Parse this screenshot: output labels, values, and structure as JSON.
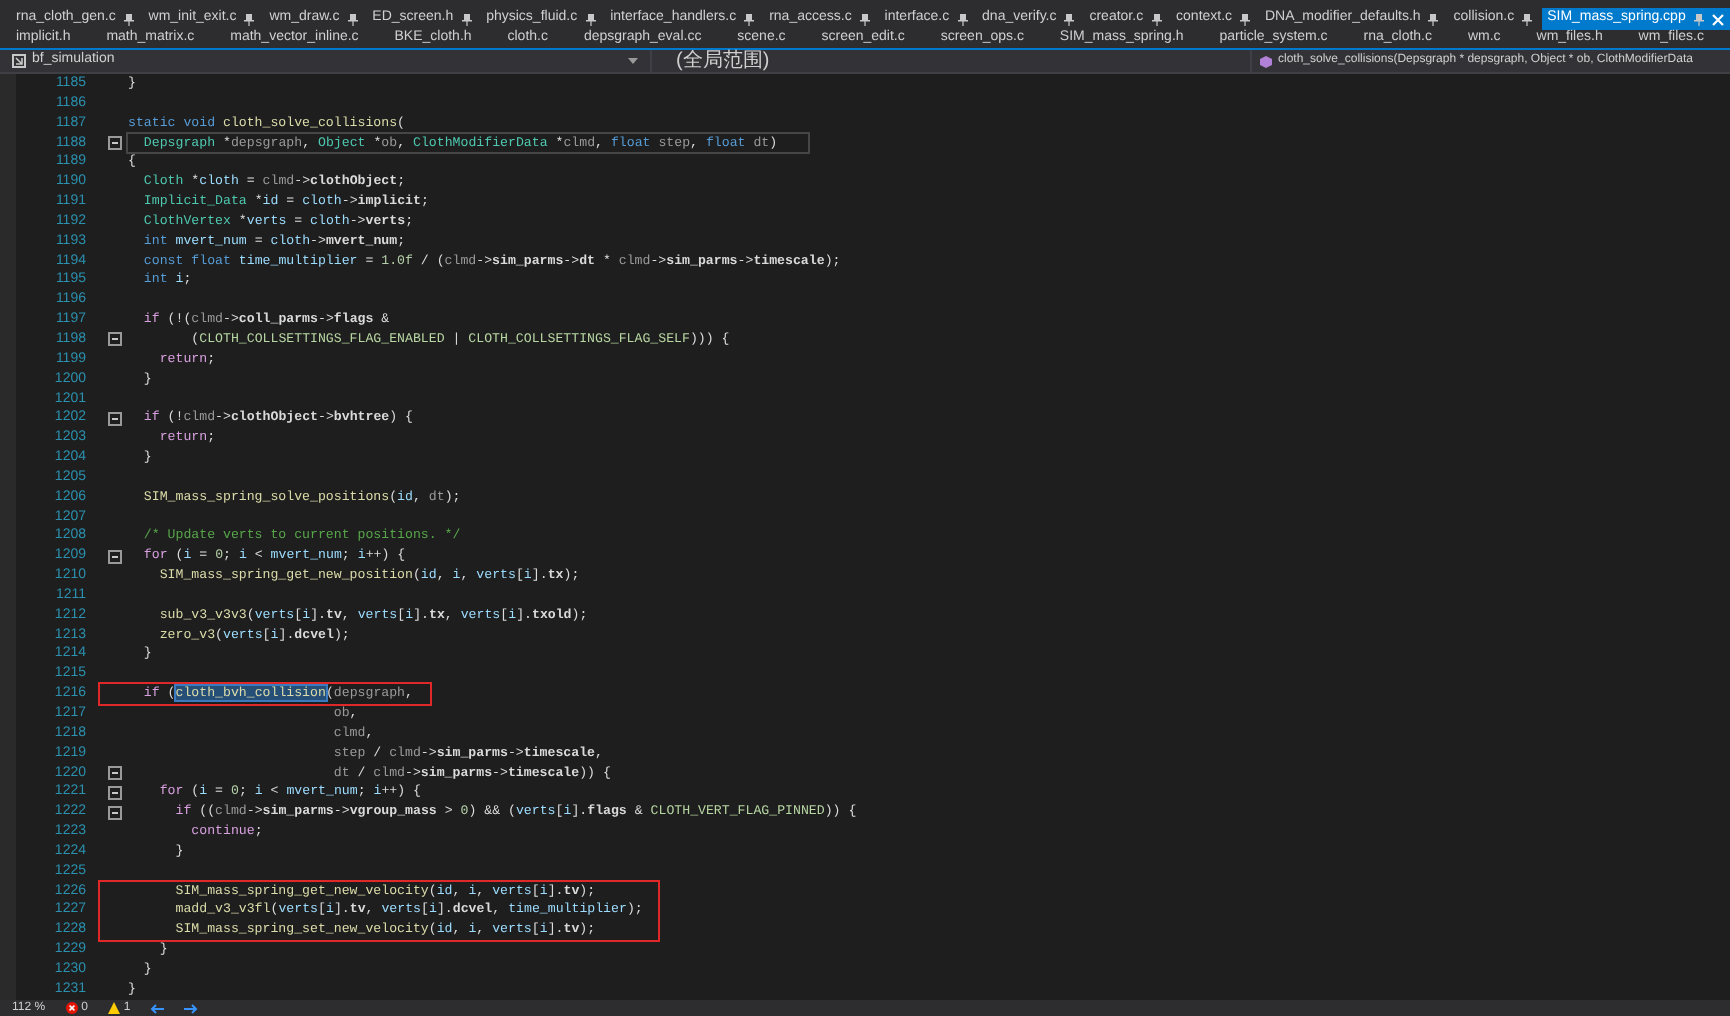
{
  "tabs_row_1": [
    {
      "label": "rna_cloth_gen.c",
      "pinned": true,
      "selected": false
    },
    {
      "label": "wm_init_exit.c",
      "pinned": true,
      "selected": false
    },
    {
      "label": "wm_draw.c",
      "pinned": true,
      "selected": false
    },
    {
      "label": "ED_screen.h",
      "pinned": true,
      "selected": false
    },
    {
      "label": "physics_fluid.c",
      "pinned": true,
      "selected": false
    },
    {
      "label": "interface_handlers.c",
      "pinned": true,
      "selected": false
    },
    {
      "label": "rna_access.c",
      "pinned": true,
      "selected": false
    },
    {
      "label": "interface.c",
      "pinned": true,
      "selected": false
    },
    {
      "label": "dna_verify.c",
      "pinned": true,
      "selected": false
    },
    {
      "label": "creator.c",
      "pinned": true,
      "selected": false
    },
    {
      "label": "context.c",
      "pinned": true,
      "selected": false
    },
    {
      "label": "DNA_modifier_defaults.h",
      "pinned": true,
      "selected": false
    },
    {
      "label": "collision.c",
      "pinned": true,
      "selected": false
    },
    {
      "label": "SIM_mass_spring.cpp",
      "pinned": true,
      "selected": true
    }
  ],
  "tabs_row_2": [
    {
      "label": "implicit.h",
      "selected": false
    },
    {
      "label": "math_matrix.c",
      "selected": false
    },
    {
      "label": "math_vector_inline.c",
      "selected": false
    },
    {
      "label": "BKE_cloth.h",
      "selected": false
    },
    {
      "label": "cloth.c",
      "selected": false
    },
    {
      "label": "depsgraph_eval.cc",
      "selected": false
    },
    {
      "label": "scene.c",
      "selected": false
    },
    {
      "label": "screen_edit.c",
      "selected": false
    },
    {
      "label": "screen_ops.c",
      "selected": false
    },
    {
      "label": "SIM_mass_spring.h",
      "selected": false
    },
    {
      "label": "particle_system.c",
      "selected": false
    },
    {
      "label": "rna_cloth.c",
      "selected": false
    },
    {
      "label": "wm.c",
      "selected": false
    },
    {
      "label": "wm_files.h",
      "selected": false
    },
    {
      "label": "wm_files.c",
      "selected": false
    }
  ],
  "navigation_bar": {
    "project": "bf_simulation",
    "scope": "(全局范围)",
    "function": "cloth_solve_collisions(Depsgraph * depsgraph, Object * ob, ClothModifierData"
  },
  "code_lines": [
    {
      "number": "1185",
      "foldable": false,
      "current": false,
      "marked": false,
      "tokens": [
        {
          "kind": "plain",
          "text": "}"
        }
      ]
    },
    {
      "number": "1186",
      "foldable": false,
      "current": false,
      "marked": false
    },
    {
      "number": "1187",
      "foldable": false,
      "current": false,
      "marked": false,
      "tokens": [
        {
          "kind": "keyword",
          "text": "static void "
        },
        {
          "kind": "function",
          "text": "cloth_solve_collisions"
        },
        {
          "kind": "plain",
          "text": "("
        }
      ]
    },
    {
      "number": "1188",
      "foldable": true,
      "current": true,
      "marked": false,
      "tokens": [
        {
          "kind": "type",
          "text": "  Depsgraph"
        },
        {
          "kind": "plain",
          "text": " *"
        },
        {
          "kind": "param",
          "text": "depsgraph"
        },
        {
          "kind": "plain",
          "text": ", "
        },
        {
          "kind": "type",
          "text": "Object"
        },
        {
          "kind": "plain",
          "text": " *"
        },
        {
          "kind": "param",
          "text": "ob"
        },
        {
          "kind": "plain",
          "text": ", "
        },
        {
          "kind": "type",
          "text": "ClothModifierData"
        },
        {
          "kind": "plain",
          "text": " *"
        },
        {
          "kind": "param",
          "text": "clmd"
        },
        {
          "kind": "plain",
          "text": ", "
        },
        {
          "kind": "keyword",
          "text": "float "
        },
        {
          "kind": "param",
          "text": "step"
        },
        {
          "kind": "plain",
          "text": ", "
        },
        {
          "kind": "keyword",
          "text": "float "
        },
        {
          "kind": "param",
          "text": "dt"
        },
        {
          "kind": "plain",
          "text": ")"
        }
      ]
    },
    {
      "number": "1189",
      "foldable": false,
      "current": false,
      "marked": false,
      "tokens": [
        {
          "kind": "plain",
          "text": "{"
        }
      ]
    },
    {
      "number": "1190",
      "foldable": false,
      "current": false,
      "marked": false,
      "tokens": [
        {
          "kind": "type",
          "text": "  Cloth"
        },
        {
          "kind": "plain",
          "text": " *"
        },
        {
          "kind": "variable",
          "text": "cloth"
        },
        {
          "kind": "plain",
          "text": " = "
        },
        {
          "kind": "param",
          "text": "clmd"
        },
        {
          "kind": "plain",
          "text": "->"
        },
        {
          "kind": "member",
          "text": "clothObject"
        },
        {
          "kind": "plain",
          "text": ";"
        }
      ]
    },
    {
      "number": "1191",
      "foldable": false,
      "current": false,
      "marked": false,
      "tokens": [
        {
          "kind": "type",
          "text": "  Implicit_Data"
        },
        {
          "kind": "plain",
          "text": " *"
        },
        {
          "kind": "variable",
          "text": "id"
        },
        {
          "kind": "plain",
          "text": " = "
        },
        {
          "kind": "variable",
          "text": "cloth"
        },
        {
          "kind": "plain",
          "text": "->"
        },
        {
          "kind": "member",
          "text": "implicit"
        },
        {
          "kind": "plain",
          "text": ";"
        }
      ]
    },
    {
      "number": "1192",
      "foldable": false,
      "current": false,
      "marked": false,
      "tokens": [
        {
          "kind": "type",
          "text": "  ClothVertex"
        },
        {
          "kind": "plain",
          "text": " *"
        },
        {
          "kind": "variable",
          "text": "verts"
        },
        {
          "kind": "plain",
          "text": " = "
        },
        {
          "kind": "variable",
          "text": "cloth"
        },
        {
          "kind": "plain",
          "text": "->"
        },
        {
          "kind": "member",
          "text": "verts"
        },
        {
          "kind": "plain",
          "text": ";"
        }
      ]
    },
    {
      "number": "1193",
      "foldable": false,
      "current": false,
      "marked": false,
      "tokens": [
        {
          "kind": "keyword",
          "text": "  int "
        },
        {
          "kind": "variable",
          "text": "mvert_num"
        },
        {
          "kind": "plain",
          "text": " = "
        },
        {
          "kind": "variable",
          "text": "cloth"
        },
        {
          "kind": "plain",
          "text": "->"
        },
        {
          "kind": "member",
          "text": "mvert_num"
        },
        {
          "kind": "plain",
          "text": ";"
        }
      ]
    },
    {
      "number": "1194",
      "foldable": false,
      "current": false,
      "marked": false,
      "tokens": [
        {
          "kind": "keyword",
          "text": "  const float "
        },
        {
          "kind": "variable",
          "text": "time_multiplier"
        },
        {
          "kind": "plain",
          "text": " = "
        },
        {
          "kind": "number",
          "text": "1.0f"
        },
        {
          "kind": "plain",
          "text": " / ("
        },
        {
          "kind": "param",
          "text": "clmd"
        },
        {
          "kind": "plain",
          "text": "->"
        },
        {
          "kind": "member",
          "text": "sim_parms"
        },
        {
          "kind": "plain",
          "text": "->"
        },
        {
          "kind": "member",
          "text": "dt"
        },
        {
          "kind": "plain",
          "text": " * "
        },
        {
          "kind": "param",
          "text": "clmd"
        },
        {
          "kind": "plain",
          "text": "->"
        },
        {
          "kind": "member",
          "text": "sim_parms"
        },
        {
          "kind": "plain",
          "text": "->"
        },
        {
          "kind": "member",
          "text": "timescale"
        },
        {
          "kind": "plain",
          "text": ");"
        }
      ]
    },
    {
      "number": "1195",
      "foldable": false,
      "current": false,
      "marked": false,
      "tokens": [
        {
          "kind": "keyword",
          "text": "  int "
        },
        {
          "kind": "variable",
          "text": "i"
        },
        {
          "kind": "plain",
          "text": ";"
        }
      ]
    },
    {
      "number": "1196",
      "foldable": false,
      "current": false,
      "marked": false
    },
    {
      "number": "1197",
      "foldable": false,
      "current": false,
      "marked": false,
      "tokens": [
        {
          "kind": "control",
          "text": "  if"
        },
        {
          "kind": "plain",
          "text": " (!("
        },
        {
          "kind": "param",
          "text": "clmd"
        },
        {
          "kind": "plain",
          "text": "->"
        },
        {
          "kind": "member",
          "text": "coll_parms"
        },
        {
          "kind": "plain",
          "text": "->"
        },
        {
          "kind": "member",
          "text": "flags"
        },
        {
          "kind": "plain",
          "text": " &"
        }
      ]
    },
    {
      "number": "1198",
      "foldable": true,
      "current": false,
      "marked": false,
      "tokens": [
        {
          "kind": "plain",
          "text": "        ("
        },
        {
          "kind": "macro",
          "text": "CLOTH_COLLSETTINGS_FLAG_ENABLED"
        },
        {
          "kind": "plain",
          "text": " | "
        },
        {
          "kind": "macro",
          "text": "CLOTH_COLLSETTINGS_FLAG_SELF"
        },
        {
          "kind": "plain",
          "text": "))) {"
        }
      ]
    },
    {
      "number": "1199",
      "foldable": false,
      "current": false,
      "marked": false,
      "tokens": [
        {
          "kind": "control",
          "text": "    return"
        },
        {
          "kind": "plain",
          "text": ";"
        }
      ]
    },
    {
      "number": "1200",
      "foldable": false,
      "current": false,
      "marked": false,
      "tokens": [
        {
          "kind": "plain",
          "text": "  }"
        }
      ]
    },
    {
      "number": "1201",
      "foldable": false,
      "current": false,
      "marked": false
    },
    {
      "number": "1202",
      "foldable": true,
      "current": false,
      "marked": false,
      "tokens": [
        {
          "kind": "control",
          "text": "  if"
        },
        {
          "kind": "plain",
          "text": " (!"
        },
        {
          "kind": "param",
          "text": "clmd"
        },
        {
          "kind": "plain",
          "text": "->"
        },
        {
          "kind": "member",
          "text": "clothObject"
        },
        {
          "kind": "plain",
          "text": "->"
        },
        {
          "kind": "member",
          "text": "bvhtree"
        },
        {
          "kind": "plain",
          "text": ") {"
        }
      ]
    },
    {
      "number": "1203",
      "foldable": false,
      "current": false,
      "marked": false,
      "tokens": [
        {
          "kind": "control",
          "text": "    return"
        },
        {
          "kind": "plain",
          "text": ";"
        }
      ]
    },
    {
      "number": "1204",
      "foldable": false,
      "current": false,
      "marked": false,
      "tokens": [
        {
          "kind": "plain",
          "text": "  }"
        }
      ]
    },
    {
      "number": "1205",
      "foldable": false,
      "current": false,
      "marked": false
    },
    {
      "number": "1206",
      "foldable": false,
      "current": false,
      "marked": false,
      "tokens": [
        {
          "kind": "function",
          "text": "  SIM_mass_spring_solve_positions"
        },
        {
          "kind": "plain",
          "text": "("
        },
        {
          "kind": "variable",
          "text": "id"
        },
        {
          "kind": "plain",
          "text": ", "
        },
        {
          "kind": "param",
          "text": "dt"
        },
        {
          "kind": "plain",
          "text": ");"
        }
      ]
    },
    {
      "number": "1207",
      "foldable": false,
      "current": false,
      "marked": false
    },
    {
      "number": "1208",
      "foldable": false,
      "current": false,
      "marked": false,
      "tokens": [
        {
          "kind": "comment",
          "text": "  /* Update verts to current positions. */"
        }
      ]
    },
    {
      "number": "1209",
      "foldable": true,
      "current": false,
      "marked": false,
      "tokens": [
        {
          "kind": "control",
          "text": "  for"
        },
        {
          "kind": "plain",
          "text": " ("
        },
        {
          "kind": "variable",
          "text": "i"
        },
        {
          "kind": "plain",
          "text": " = "
        },
        {
          "kind": "number",
          "text": "0"
        },
        {
          "kind": "plain",
          "text": "; "
        },
        {
          "kind": "variable",
          "text": "i"
        },
        {
          "kind": "plain",
          "text": " < "
        },
        {
          "kind": "variable",
          "text": "mvert_num"
        },
        {
          "kind": "plain",
          "text": "; "
        },
        {
          "kind": "variable",
          "text": "i"
        },
        {
          "kind": "plain",
          "text": "++) {"
        }
      ]
    },
    {
      "number": "1210",
      "foldable": false,
      "current": false,
      "marked": false,
      "tokens": [
        {
          "kind": "function",
          "text": "    SIM_mass_spring_get_new_position"
        },
        {
          "kind": "plain",
          "text": "("
        },
        {
          "kind": "variable",
          "text": "id"
        },
        {
          "kind": "plain",
          "text": ", "
        },
        {
          "kind": "variable",
          "text": "i"
        },
        {
          "kind": "plain",
          "text": ", "
        },
        {
          "kind": "variable",
          "text": "verts"
        },
        {
          "kind": "plain",
          "text": "["
        },
        {
          "kind": "variable",
          "text": "i"
        },
        {
          "kind": "plain",
          "text": "]."
        },
        {
          "kind": "member",
          "text": "tx"
        },
        {
          "kind": "plain",
          "text": ");"
        }
      ]
    },
    {
      "number": "1211",
      "foldable": false,
      "current": false,
      "marked": false
    },
    {
      "number": "1212",
      "foldable": false,
      "current": false,
      "marked": false,
      "tokens": [
        {
          "kind": "function",
          "text": "    sub_v3_v3v3"
        },
        {
          "kind": "plain",
          "text": "("
        },
        {
          "kind": "variable",
          "text": "verts"
        },
        {
          "kind": "plain",
          "text": "["
        },
        {
          "kind": "variable",
          "text": "i"
        },
        {
          "kind": "plain",
          "text": "]."
        },
        {
          "kind": "member",
          "text": "tv"
        },
        {
          "kind": "plain",
          "text": ", "
        },
        {
          "kind": "variable",
          "text": "verts"
        },
        {
          "kind": "plain",
          "text": "["
        },
        {
          "kind": "variable",
          "text": "i"
        },
        {
          "kind": "plain",
          "text": "]."
        },
        {
          "kind": "member",
          "text": "tx"
        },
        {
          "kind": "plain",
          "text": ", "
        },
        {
          "kind": "variable",
          "text": "verts"
        },
        {
          "kind": "plain",
          "text": "["
        },
        {
          "kind": "variable",
          "text": "i"
        },
        {
          "kind": "plain",
          "text": "]."
        },
        {
          "kind": "member",
          "text": "txold"
        },
        {
          "kind": "plain",
          "text": ");"
        }
      ]
    },
    {
      "number": "1213",
      "foldable": false,
      "current": false,
      "marked": false,
      "tokens": [
        {
          "kind": "function",
          "text": "    zero_v3"
        },
        {
          "kind": "plain",
          "text": "("
        },
        {
          "kind": "variable",
          "text": "verts"
        },
        {
          "kind": "plain",
          "text": "["
        },
        {
          "kind": "variable",
          "text": "i"
        },
        {
          "kind": "plain",
          "text": "]."
        },
        {
          "kind": "member",
          "text": "dcvel"
        },
        {
          "kind": "plain",
          "text": ");"
        }
      ]
    },
    {
      "number": "1214",
      "foldable": false,
      "current": false,
      "marked": false,
      "tokens": [
        {
          "kind": "plain",
          "text": "  }"
        }
      ]
    },
    {
      "number": "1215",
      "foldable": false,
      "current": false,
      "marked": false
    },
    {
      "number": "1216",
      "foldable": false,
      "current": false,
      "marked": true,
      "tokens": [
        {
          "kind": "control",
          "text": "  if"
        },
        {
          "kind": "plain",
          "text": " ("
        },
        {
          "kind": "function",
          "text": "cloth_bvh_collision",
          "selected": true
        },
        {
          "kind": "plain",
          "text": "("
        },
        {
          "kind": "param",
          "text": "depsgraph"
        },
        {
          "kind": "plain",
          "text": ","
        }
      ]
    },
    {
      "number": "1217",
      "foldable": false,
      "current": false,
      "marked": false,
      "tokens": [
        {
          "kind": "param",
          "text": "                          ob"
        },
        {
          "kind": "plain",
          "text": ","
        }
      ]
    },
    {
      "number": "1218",
      "foldable": false,
      "current": false,
      "marked": false,
      "tokens": [
        {
          "kind": "param",
          "text": "                          clmd"
        },
        {
          "kind": "plain",
          "text": ","
        }
      ]
    },
    {
      "number": "1219",
      "foldable": false,
      "current": false,
      "marked": false,
      "tokens": [
        {
          "kind": "param",
          "text": "                          step"
        },
        {
          "kind": "plain",
          "text": " / "
        },
        {
          "kind": "param",
          "text": "clmd"
        },
        {
          "kind": "plain",
          "text": "->"
        },
        {
          "kind": "member",
          "text": "sim_parms"
        },
        {
          "kind": "plain",
          "text": "->"
        },
        {
          "kind": "member",
          "text": "timescale"
        },
        {
          "kind": "plain",
          "text": ","
        }
      ]
    },
    {
      "number": "1220",
      "foldable": true,
      "current": false,
      "marked": false,
      "tokens": [
        {
          "kind": "param",
          "text": "                          dt"
        },
        {
          "kind": "plain",
          "text": " / "
        },
        {
          "kind": "param",
          "text": "clmd"
        },
        {
          "kind": "plain",
          "text": "->"
        },
        {
          "kind": "member",
          "text": "sim_parms"
        },
        {
          "kind": "plain",
          "text": "->"
        },
        {
          "kind": "member",
          "text": "timescale"
        },
        {
          "kind": "plain",
          "text": ")) {"
        }
      ]
    },
    {
      "number": "1221",
      "foldable": true,
      "current": false,
      "marked": false,
      "tokens": [
        {
          "kind": "control",
          "text": "    for"
        },
        {
          "kind": "plain",
          "text": " ("
        },
        {
          "kind": "variable",
          "text": "i"
        },
        {
          "kind": "plain",
          "text": " = "
        },
        {
          "kind": "number",
          "text": "0"
        },
        {
          "kind": "plain",
          "text": "; "
        },
        {
          "kind": "variable",
          "text": "i"
        },
        {
          "kind": "plain",
          "text": " < "
        },
        {
          "kind": "variable",
          "text": "mvert_num"
        },
        {
          "kind": "plain",
          "text": "; "
        },
        {
          "kind": "variable",
          "text": "i"
        },
        {
          "kind": "plain",
          "text": "++) {"
        }
      ]
    },
    {
      "number": "1222",
      "foldable": true,
      "current": false,
      "marked": false,
      "tokens": [
        {
          "kind": "control",
          "text": "      if"
        },
        {
          "kind": "plain",
          "text": " (("
        },
        {
          "kind": "param",
          "text": "clmd"
        },
        {
          "kind": "plain",
          "text": "->"
        },
        {
          "kind": "member",
          "text": "sim_parms"
        },
        {
          "kind": "plain",
          "text": "->"
        },
        {
          "kind": "member",
          "text": "vgroup_mass"
        },
        {
          "kind": "plain",
          "text": " > "
        },
        {
          "kind": "number",
          "text": "0"
        },
        {
          "kind": "plain",
          "text": ") && ("
        },
        {
          "kind": "variable",
          "text": "verts"
        },
        {
          "kind": "plain",
          "text": "["
        },
        {
          "kind": "variable",
          "text": "i"
        },
        {
          "kind": "plain",
          "text": "]."
        },
        {
          "kind": "member",
          "text": "flags"
        },
        {
          "kind": "plain",
          "text": " & "
        },
        {
          "kind": "macro",
          "text": "CLOTH_VERT_FLAG_PINNED"
        },
        {
          "kind": "plain",
          "text": ")) {"
        }
      ]
    },
    {
      "number": "1223",
      "foldable": false,
      "current": false,
      "marked": false,
      "tokens": [
        {
          "kind": "control",
          "text": "        continue"
        },
        {
          "kind": "plain",
          "text": ";"
        }
      ]
    },
    {
      "number": "1224",
      "foldable": false,
      "current": false,
      "marked": false,
      "tokens": [
        {
          "kind": "plain",
          "text": "      }"
        }
      ]
    },
    {
      "number": "1225",
      "foldable": false,
      "current": false,
      "marked": false
    },
    {
      "number": "1226",
      "foldable": false,
      "current": false,
      "marked": true,
      "tokens": [
        {
          "kind": "function",
          "text": "      SIM_mass_spring_get_new_velocity"
        },
        {
          "kind": "plain",
          "text": "("
        },
        {
          "kind": "variable",
          "text": "id"
        },
        {
          "kind": "plain",
          "text": ", "
        },
        {
          "kind": "variable",
          "text": "i"
        },
        {
          "kind": "plain",
          "text": ", "
        },
        {
          "kind": "variable",
          "text": "verts"
        },
        {
          "kind": "plain",
          "text": "["
        },
        {
          "kind": "variable",
          "text": "i"
        },
        {
          "kind": "plain",
          "text": "]."
        },
        {
          "kind": "member",
          "text": "tv"
        },
        {
          "kind": "plain",
          "text": ");"
        }
      ]
    },
    {
      "number": "1227",
      "foldable": false,
      "current": false,
      "marked": true,
      "tokens": [
        {
          "kind": "function",
          "text": "      madd_v3_v3fl"
        },
        {
          "kind": "plain",
          "text": "("
        },
        {
          "kind": "variable",
          "text": "verts"
        },
        {
          "kind": "plain",
          "text": "["
        },
        {
          "kind": "variable",
          "text": "i"
        },
        {
          "kind": "plain",
          "text": "]."
        },
        {
          "kind": "member",
          "text": "tv"
        },
        {
          "kind": "plain",
          "text": ", "
        },
        {
          "kind": "variable",
          "text": "verts"
        },
        {
          "kind": "plain",
          "text": "["
        },
        {
          "kind": "variable",
          "text": "i"
        },
        {
          "kind": "plain",
          "text": "]."
        },
        {
          "kind": "member",
          "text": "dcvel"
        },
        {
          "kind": "plain",
          "text": ", "
        },
        {
          "kind": "variable",
          "text": "time_multiplier"
        },
        {
          "kind": "plain",
          "text": ");"
        }
      ]
    },
    {
      "number": "1228",
      "foldable": false,
      "current": false,
      "marked": true,
      "tokens": [
        {
          "kind": "function",
          "text": "      SIM_mass_spring_set_new_velocity"
        },
        {
          "kind": "plain",
          "text": "("
        },
        {
          "kind": "variable",
          "text": "id"
        },
        {
          "kind": "plain",
          "text": ", "
        },
        {
          "kind": "variable",
          "text": "i"
        },
        {
          "kind": "plain",
          "text": ", "
        },
        {
          "kind": "variable",
          "text": "verts"
        },
        {
          "kind": "plain",
          "text": "["
        },
        {
          "kind": "variable",
          "text": "i"
        },
        {
          "kind": "plain",
          "text": "]."
        },
        {
          "kind": "member",
          "text": "tv"
        },
        {
          "kind": "plain",
          "text": ");"
        }
      ]
    },
    {
      "number": "1229",
      "foldable": false,
      "current": false,
      "marked": false,
      "tokens": [
        {
          "kind": "plain",
          "text": "    }"
        }
      ]
    },
    {
      "number": "1230",
      "foldable": false,
      "current": false,
      "marked": false,
      "tokens": [
        {
          "kind": "plain",
          "text": "  }"
        }
      ]
    },
    {
      "number": "1231",
      "foldable": false,
      "current": false,
      "marked": false,
      "tokens": [
        {
          "kind": "plain",
          "text": "}"
        }
      ]
    }
  ],
  "status_bar": {
    "zoom": "112 %",
    "errors": "0",
    "warnings": "1"
  }
}
